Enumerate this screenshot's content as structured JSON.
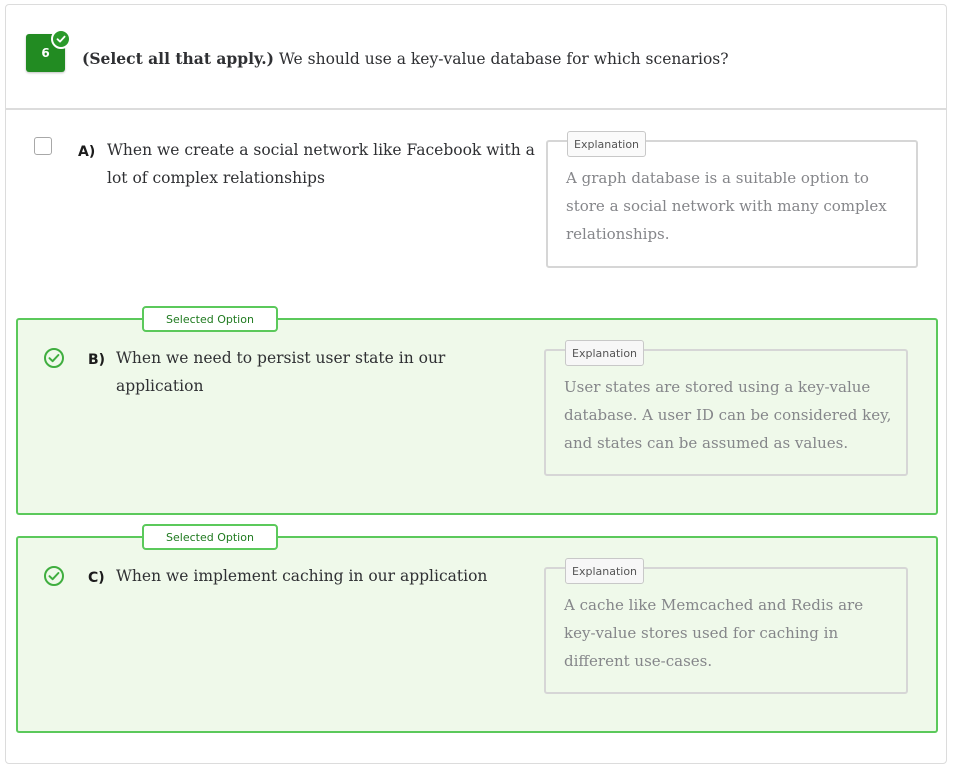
{
  "question": {
    "number": "6",
    "prefix": "(Select all that apply.)",
    "text": " We should use a key-value database for which scenarios?"
  },
  "options": [
    {
      "letter": "A)",
      "text": "When we create a social network like Facebook with a lot of complex relationships",
      "selected": false,
      "explanation_label": "Explanation",
      "explanation": "A graph database is a suitable option to store a social network with many complex relationships."
    },
    {
      "letter": "B)",
      "text": "When we need to persist user state in our application",
      "selected": true,
      "selected_label": "Selected Option",
      "explanation_label": "Explanation",
      "explanation": "User states are stored using a key-value database. A user ID can be considered key, and states can be assumed as values."
    },
    {
      "letter": "C)",
      "text": "When we implement caching in our application",
      "selected": true,
      "selected_label": "Selected Option",
      "explanation_label": "Explanation",
      "explanation": "A cache like Memcached and Redis are key-value stores used for caching in different use-cases."
    }
  ],
  "colors": {
    "question_badge": "#228b22",
    "selected_border": "#5bc95b",
    "selected_bg": "#eff9ea",
    "explanation_text": "#85868a"
  },
  "icons": {
    "badge_status": "check-circle-icon",
    "option_selected": "check-circle-icon",
    "option_unselected": "checkbox-icon"
  }
}
